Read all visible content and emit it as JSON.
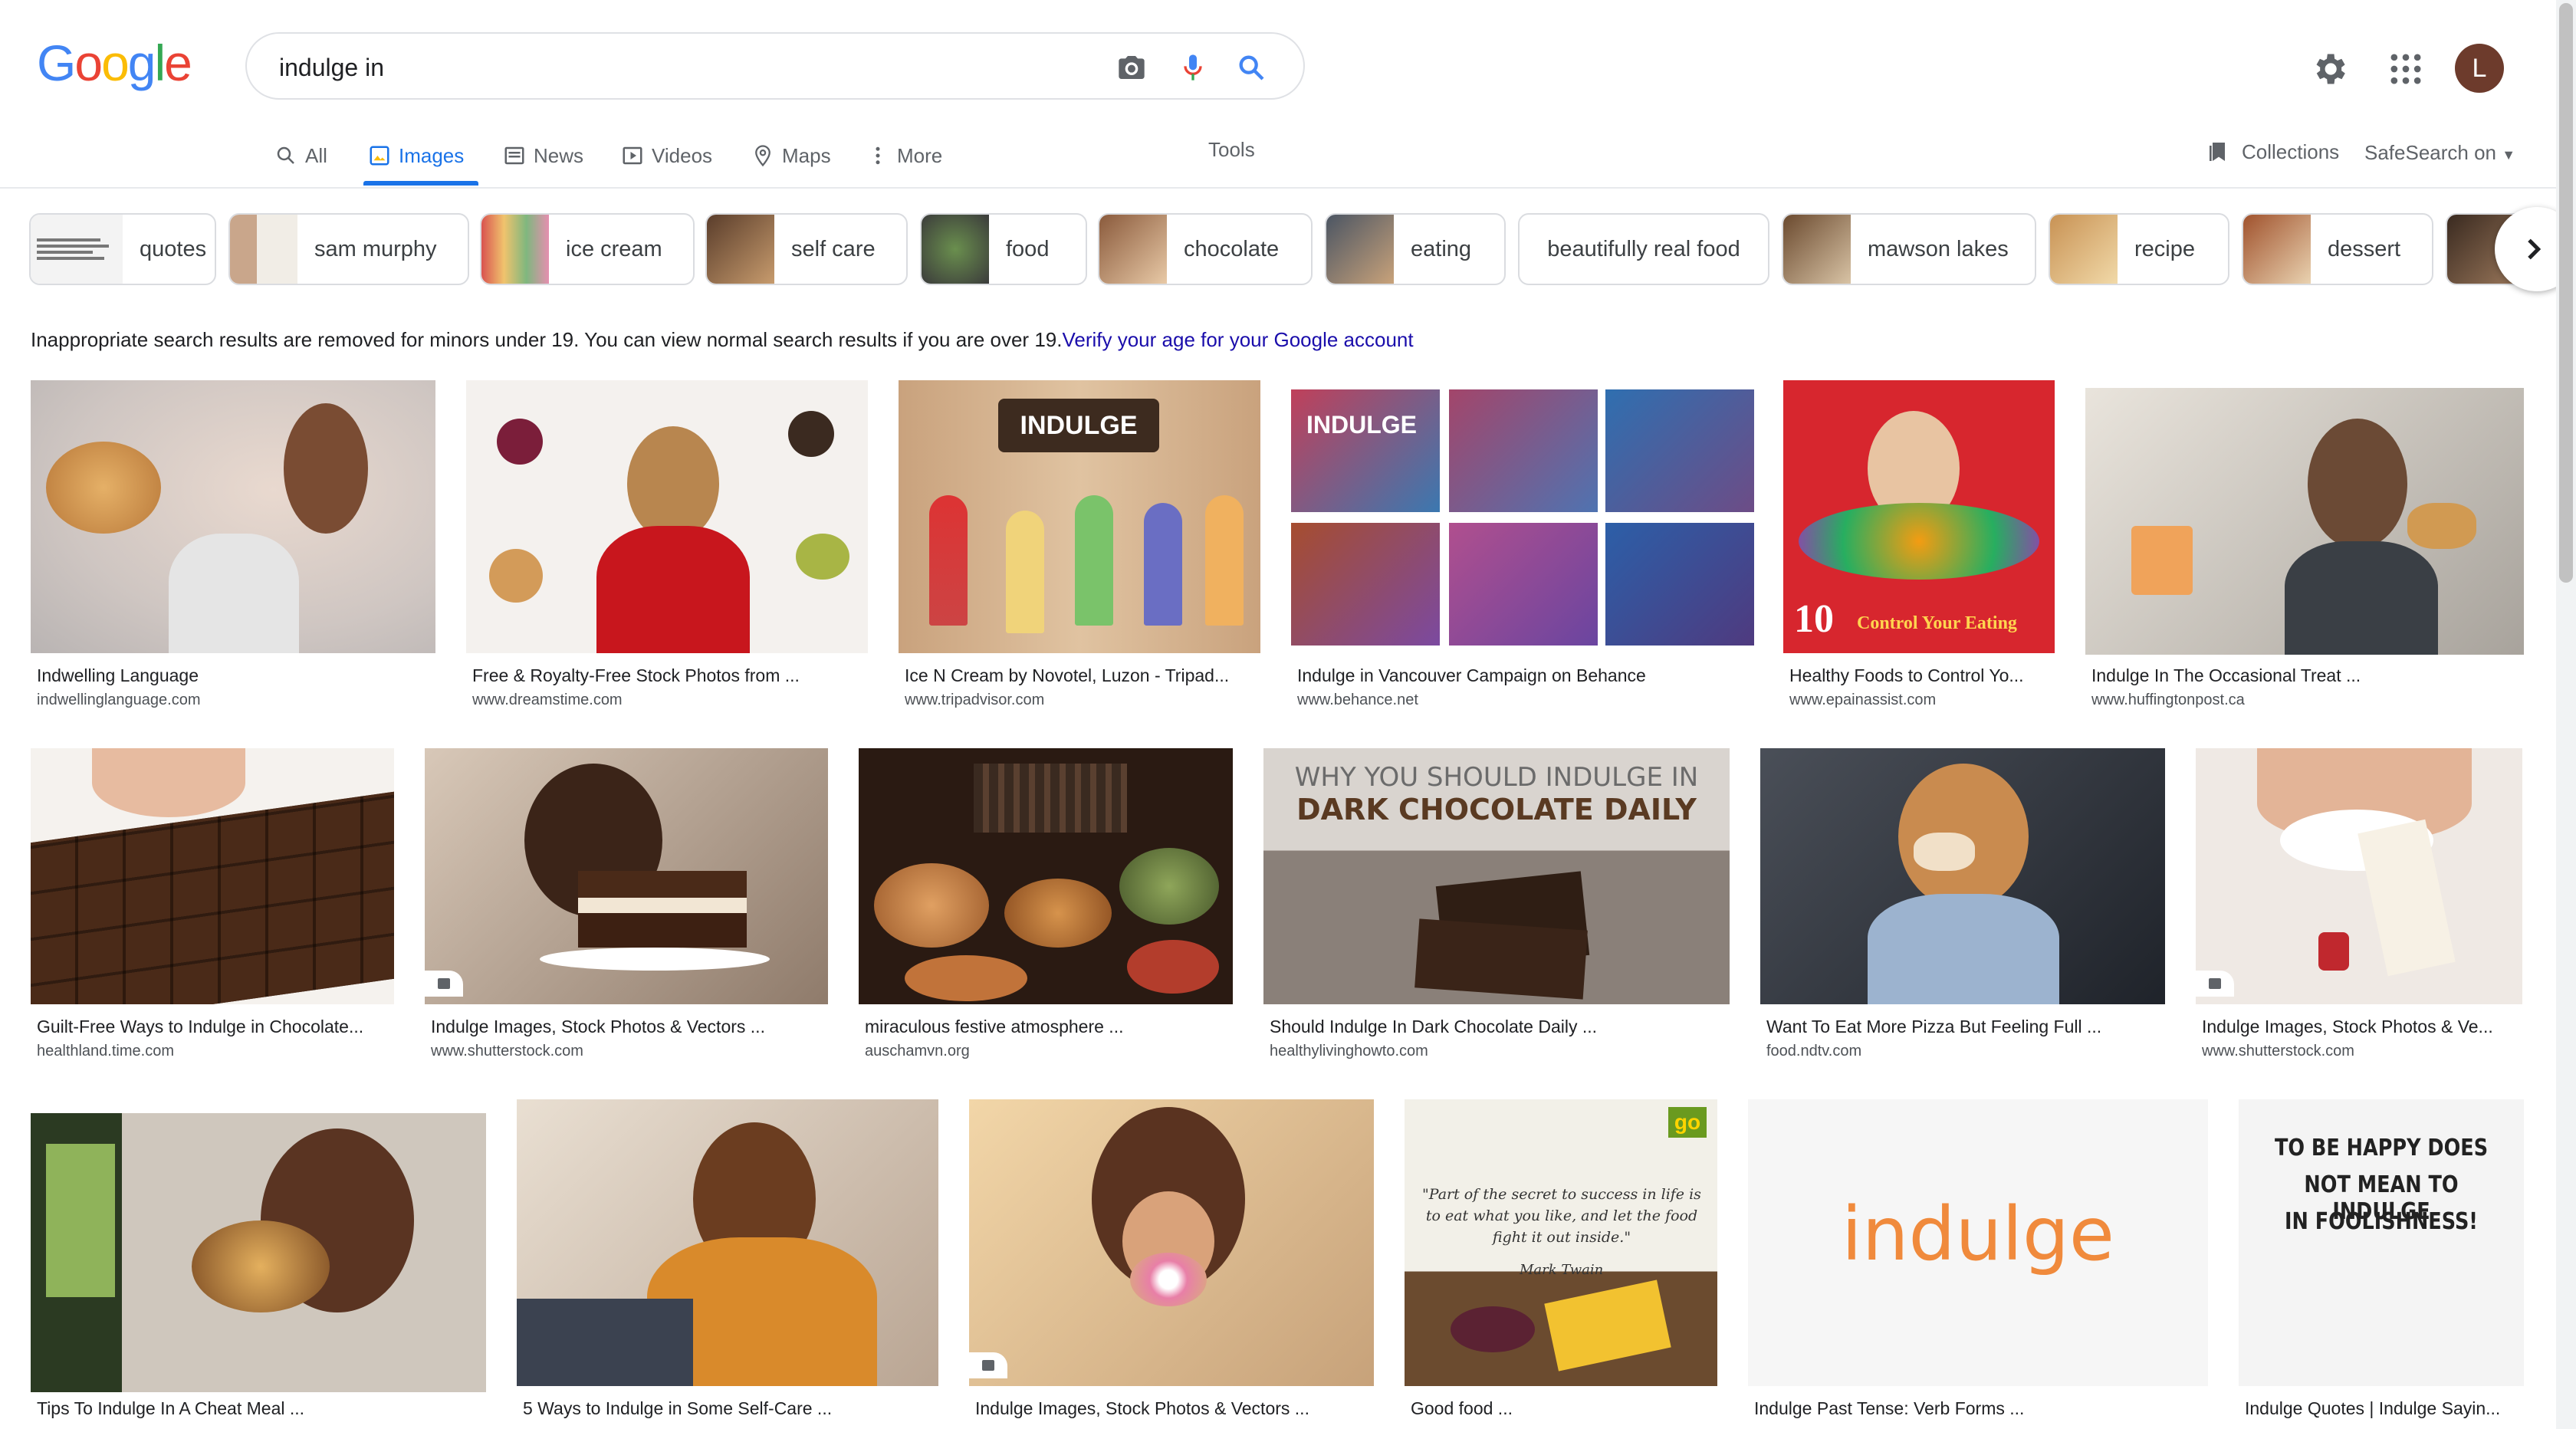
{
  "header": {
    "search_value": "indulge in",
    "avatar_letter": "L"
  },
  "tabs": [
    {
      "label": "All"
    },
    {
      "label": "Images"
    },
    {
      "label": "News"
    },
    {
      "label": "Videos"
    },
    {
      "label": "Maps"
    },
    {
      "label": "More"
    }
  ],
  "tools_label": "Tools",
  "collections_label": "Collections",
  "safesearch_label": "SafeSearch on",
  "chips": [
    "quotes",
    "sam murphy",
    "ice cream",
    "self care",
    "food",
    "chocolate",
    "eating",
    "beautifully real food",
    "mawson lakes",
    "recipe",
    "dessert"
  ],
  "notice": {
    "text": "Inappropriate search results are removed for minors under 19. You can view normal search results if you are over 19.",
    "link": "Verify your age for your Google account"
  },
  "results": [
    {
      "title": "Indwelling Language",
      "source": "indwellinglanguage.com"
    },
    {
      "title": "Free & Royalty-Free Stock Photos from ...",
      "source": "www.dreamstime.com"
    },
    {
      "title": "Ice N Cream by Novotel, Luzon - Tripad...",
      "source": "www.tripadvisor.com"
    },
    {
      "title": "Indulge in Vancouver Campaign on Behance",
      "source": "www.behance.net"
    },
    {
      "title": "Healthy Foods to Control Yo...",
      "source": "www.epainassist.com"
    },
    {
      "title": "Indulge In The Occasional Treat ...",
      "source": "www.huffingtonpost.ca"
    },
    {
      "title": "Guilt-Free Ways to Indulge in Chocolate...",
      "source": "healthland.time.com"
    },
    {
      "title": "Indulge Images, Stock Photos & Vectors ...",
      "source": "www.shutterstock.com"
    },
    {
      "title": "miraculous festive atmosphere ...",
      "source": "auschamvn.org"
    },
    {
      "title": "Should Indulge In Dark Chocolate Daily ...",
      "source": "healthylivinghowto.com"
    },
    {
      "title": "Want To Eat More Pizza But Feeling Full ...",
      "source": "food.ndtv.com"
    },
    {
      "title": "Indulge Images, Stock Photos & Ve...",
      "source": "www.shutterstock.com"
    },
    {
      "title": "Tips To Indulge In A Cheat Meal ...",
      "source": ""
    },
    {
      "title": "5 Ways to Indulge in Some Self-Care ...",
      "source": ""
    },
    {
      "title": "Indulge Images, Stock Photos & Vectors ...",
      "source": ""
    },
    {
      "title": "Good food ...",
      "source": ""
    },
    {
      "title": "Indulge Past Tense: Verb Forms ...",
      "source": ""
    },
    {
      "title": "Indulge Quotes | Indulge Sayin...",
      "source": ""
    }
  ],
  "image_text": {
    "r3": "INDULGE",
    "r4": "INDULGE",
    "r5_num": "10",
    "r5_line": "Control Your Eating",
    "r10_line1": "WHY YOU SHOULD INDULGE IN",
    "r10_line2": "DARK CHOCOLATE DAILY",
    "r16_badge": "go",
    "r16_quote": "\"Part of the secret to success in life is to eat what you like, and let the food fight it out inside.\"",
    "r16_author": "Mark Twain",
    "r17_word": "indulge",
    "r18_line1": "TO BE HAPPY DOES",
    "r18_line2": "NOT MEAN TO INDULGE",
    "r18_line3": "IN FOOLISHNESS!"
  },
  "colors": {
    "accent": "#1a73e8",
    "link": "#1a0dab"
  }
}
